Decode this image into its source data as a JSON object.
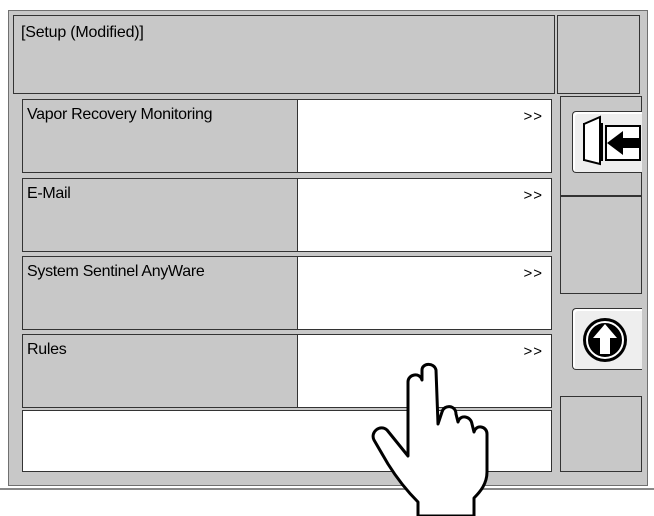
{
  "header": {
    "title": "[Setup (Modified)]"
  },
  "menu": {
    "items": [
      {
        "label": "Vapor Recovery Monitoring",
        "value": "",
        "arrow": ">>"
      },
      {
        "label": "E-Mail",
        "value": "",
        "arrow": ">>"
      },
      {
        "label": "System Sentinel AnyWare",
        "value": "",
        "arrow": ">>"
      },
      {
        "label": "Rules",
        "value": "",
        "arrow": ">>"
      }
    ]
  },
  "side": {
    "buttons": [
      "exit-icon",
      "up-arrow-icon"
    ]
  },
  "cursor": {
    "icon": "hand-pointer-icon"
  }
}
